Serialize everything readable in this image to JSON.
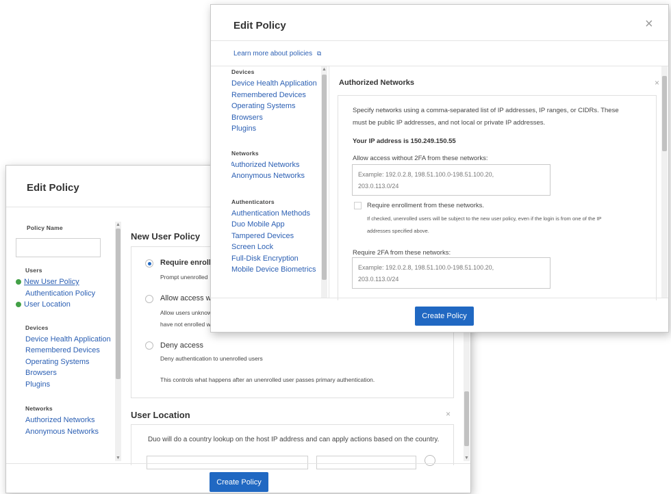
{
  "back_dialog": {
    "title": "Edit Policy",
    "policy_name_label": "Policy Name",
    "policy_name_value": "",
    "nav": {
      "users_header": "Users",
      "users_items": [
        "New User Policy",
        "Authentication Policy",
        "User Location"
      ],
      "devices_header": "Devices",
      "devices_items": [
        "Device Health Application",
        "Remembered Devices",
        "Operating Systems",
        "Browsers",
        "Plugins"
      ],
      "networks_header": "Networks",
      "networks_items": [
        "Authorized Networks",
        "Anonymous Networks"
      ]
    },
    "new_user_policy": {
      "title": "New User Policy",
      "option1_label": "Require enrollm",
      "option1_desc": "Prompt unenrolled",
      "option2_label": "Allow access wit",
      "option2_desc_line1": "Allow users unknow",
      "option2_desc_line2": "have not enrolled w",
      "option3_label": "Deny access",
      "option3_desc": "Deny authentication to unenrolled users",
      "footer": "This controls what happens after an unenrolled user passes primary authentication."
    },
    "user_location": {
      "title": "User Location",
      "description": "Duo will do a country lookup on the host IP address and can apply actions based on the country."
    },
    "create_button": "Create Policy"
  },
  "front_dialog": {
    "title": "Edit Policy",
    "close_label": "×",
    "learn_more": "Learn more about policies",
    "nav": {
      "devices_header": "Devices",
      "devices_items": [
        "Device Health Application",
        "Remembered Devices",
        "Operating Systems",
        "Browsers",
        "Plugins"
      ],
      "networks_header": "Networks",
      "networks_items": [
        "Authorized Networks",
        "Anonymous Networks"
      ],
      "authenticators_header": "Authenticators",
      "authenticators_items": [
        "Authentication Methods",
        "Duo Mobile App",
        "Tampered Devices",
        "Screen Lock",
        "Full-Disk Encryption",
        "Mobile Device Biometrics"
      ]
    },
    "authorized_networks": {
      "title": "Authorized Networks",
      "close_label": "×",
      "intro_line1": "Specify networks using a comma-separated list of IP addresses, IP ranges, or CIDRs. These",
      "intro_line2": "must be public IP addresses, and not local or private IP addresses.",
      "your_ip": "Your IP address is 150.249.150.55",
      "allow_label": "Allow access without 2FA from these networks:",
      "allow_placeholder_line1": "Example: 192.0.2.8, 198.51.100.0-198.51.100.20,",
      "allow_placeholder_line2": "203.0.113.0/24",
      "enroll_checkbox_label": "Require enrollment from these networks.",
      "enroll_note_line1": "If checked, unenrolled users will be subject to the new user policy, even if the login is from one of the IP",
      "enroll_note_line2": "addresses specified above.",
      "require_label": "Require 2FA from these networks:",
      "require_placeholder_line1": "Example: 192.0.2.8, 198.51.100.0-198.51.100.20,",
      "require_placeholder_line2": "203.0.113.0/24"
    },
    "create_button": "Create Policy"
  },
  "colors": {
    "link": "#2b5fb3",
    "primary_button": "#2068c2",
    "check_green": "#43a047"
  }
}
